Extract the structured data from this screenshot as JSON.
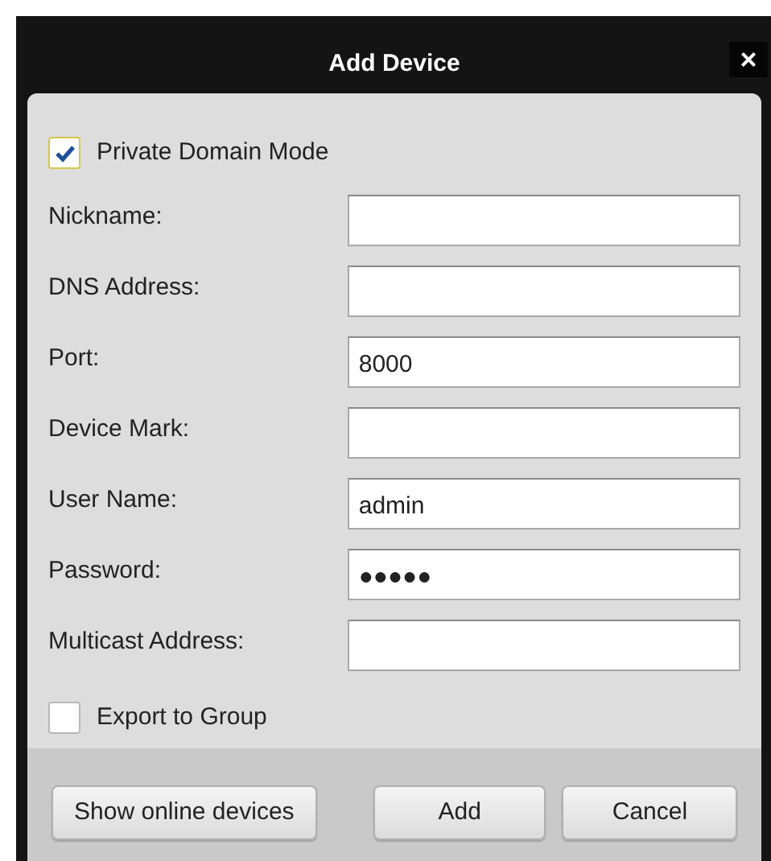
{
  "window": {
    "title": "Add Device",
    "close": "×"
  },
  "private_domain_mode": {
    "label": "Private Domain Mode",
    "checked": true
  },
  "fields": [
    {
      "label": "Nickname:"
    },
    {
      "label": "DNS Address:"
    },
    {
      "label": "Port:",
      "value": "8000"
    },
    {
      "label": "Device Mark:"
    },
    {
      "label": "User Name:",
      "value": "admin"
    },
    {
      "label": "Password:",
      "value": "●●●●●"
    },
    {
      "label": "Multicast Address:"
    }
  ],
  "export_to_group": {
    "label": "Export to Group",
    "checked": false
  },
  "buttons": {
    "left": "Show online devices",
    "ok": "Add",
    "cancel": "Cancel"
  }
}
